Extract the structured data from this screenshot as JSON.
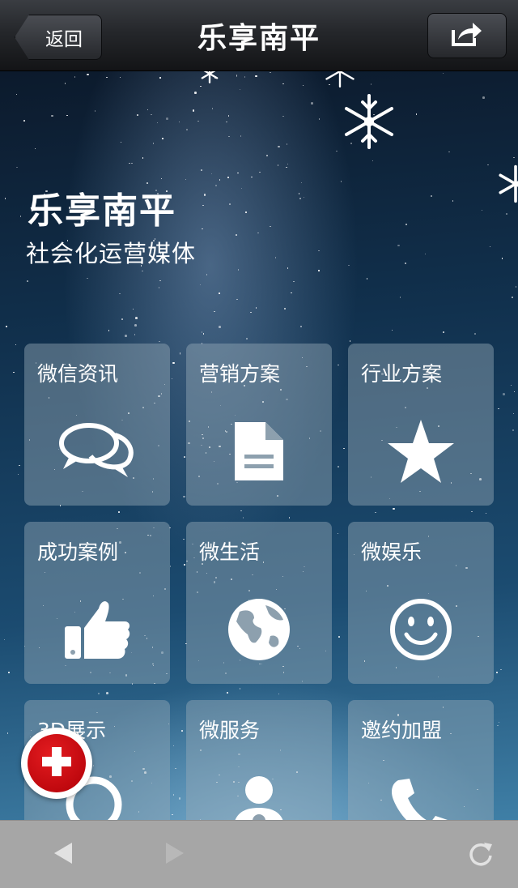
{
  "navbar": {
    "back_label": "返回",
    "title": "乐享南平",
    "share_icon": "share-icon"
  },
  "hero": {
    "title": "乐享南平",
    "subtitle": "社会化运营媒体"
  },
  "tiles": [
    {
      "label": "微信资讯",
      "icon": "chat-bubbles-icon"
    },
    {
      "label": "营销方案",
      "icon": "document-icon"
    },
    {
      "label": "行业方案",
      "icon": "star-icon"
    },
    {
      "label": "成功案例",
      "icon": "thumbs-up-icon"
    },
    {
      "label": "微生活",
      "icon": "globe-icon"
    },
    {
      "label": "微娱乐",
      "icon": "smiley-icon"
    },
    {
      "label": "3D展示",
      "icon": "search-icon"
    },
    {
      "label": "微服务",
      "icon": "person-icon"
    },
    {
      "label": "邀约加盟",
      "icon": "phone-icon"
    }
  ],
  "fab": {
    "icon": "plus-icon"
  },
  "toolbar": {
    "back_icon": "arrow-left-icon",
    "forward_icon": "arrow-right-icon",
    "reload_icon": "reload-icon"
  },
  "colors": {
    "navbar_top": "#3a3d42",
    "navbar_bottom": "#131416",
    "tile_bg": "rgba(150,170,185,0.45)",
    "fab_red": "#d0101a",
    "toolbar_bg": "#a6a6a6"
  }
}
